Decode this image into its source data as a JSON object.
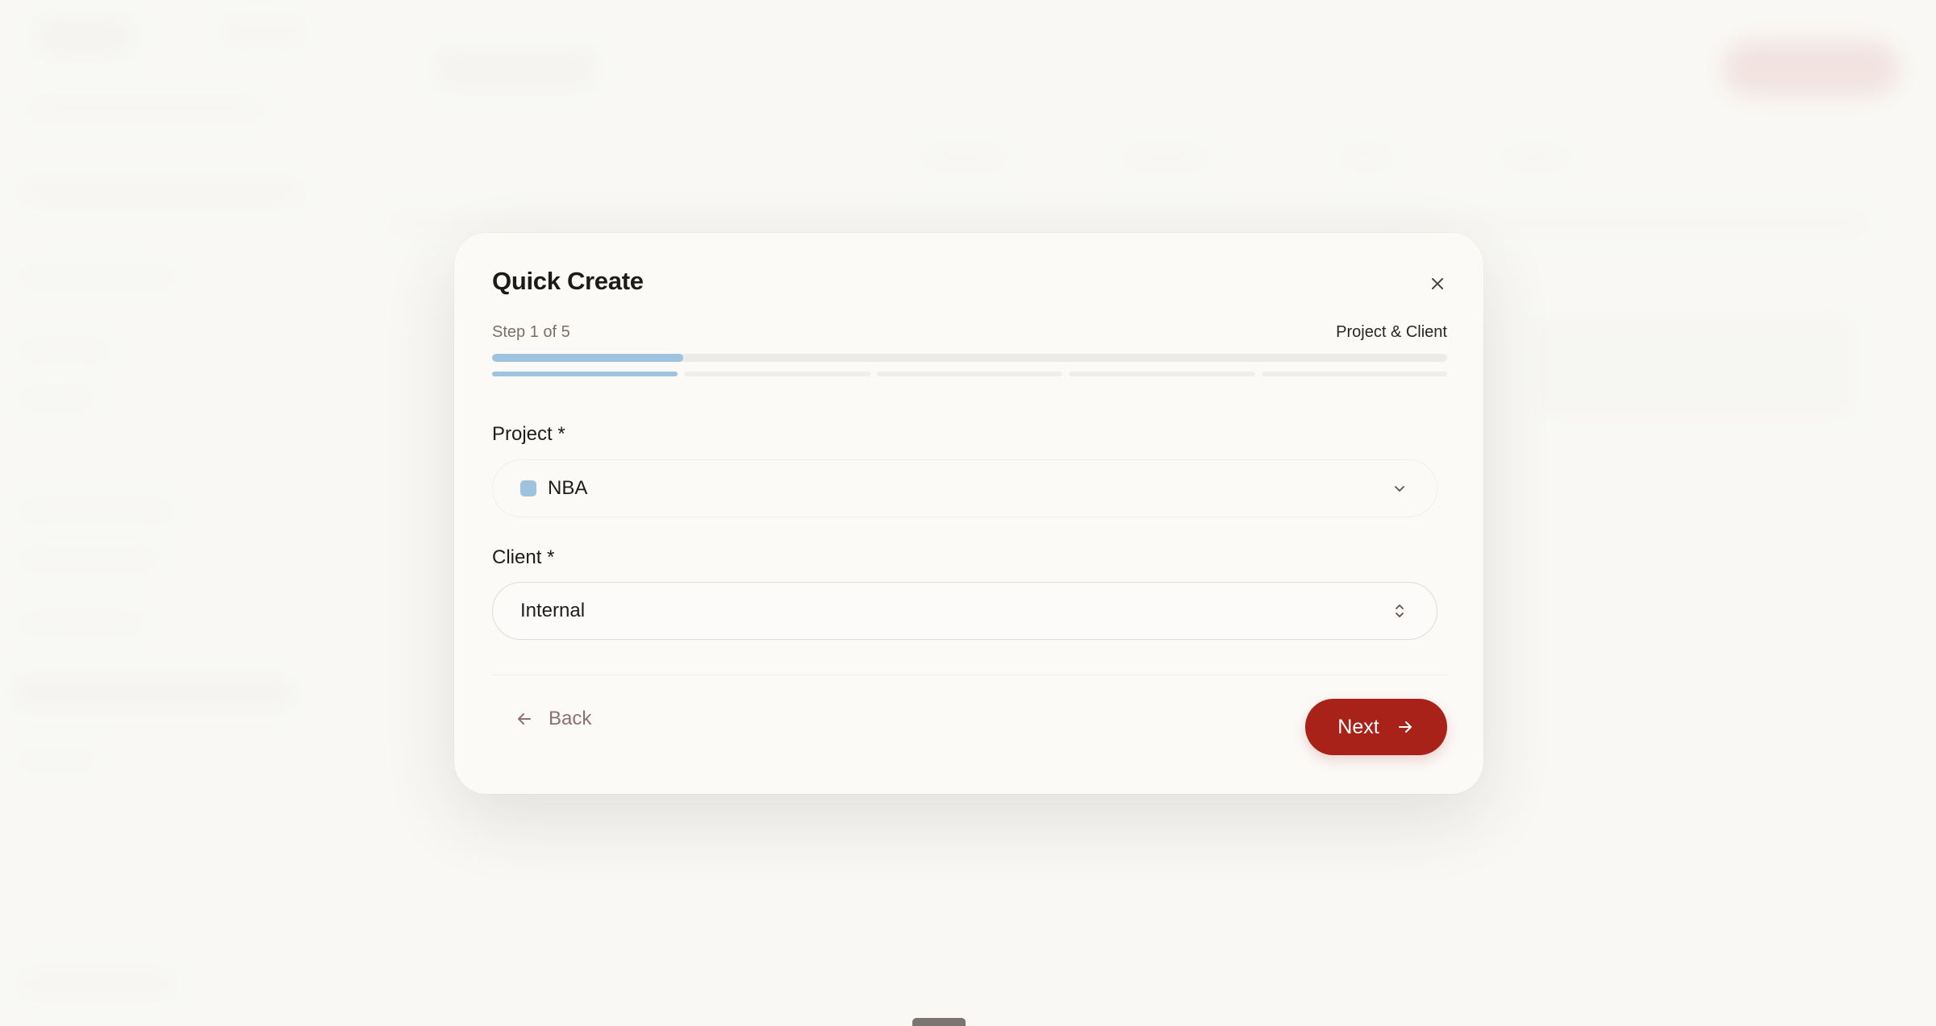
{
  "modal": {
    "title": "Quick Create",
    "step_label": "Step 1 of 5",
    "step_name": "Project & Client",
    "progress": 0.2,
    "steps_total": 5,
    "steps_completed": 1,
    "progress_color": "#9ec3de",
    "fields": {
      "project": {
        "label": "Project *",
        "value": "NBA",
        "swatch_color": "#9ec3de",
        "icon": "chevron-down-icon"
      },
      "client": {
        "label": "Client *",
        "value": "Internal",
        "icon": "chevron-up-down-icon"
      }
    },
    "footer": {
      "back_label": "Back",
      "back_icon": "arrow-left-icon",
      "next_label": "Next",
      "next_icon": "arrow-right-icon",
      "next_color": "#a92219"
    },
    "close_icon": "close-icon"
  }
}
